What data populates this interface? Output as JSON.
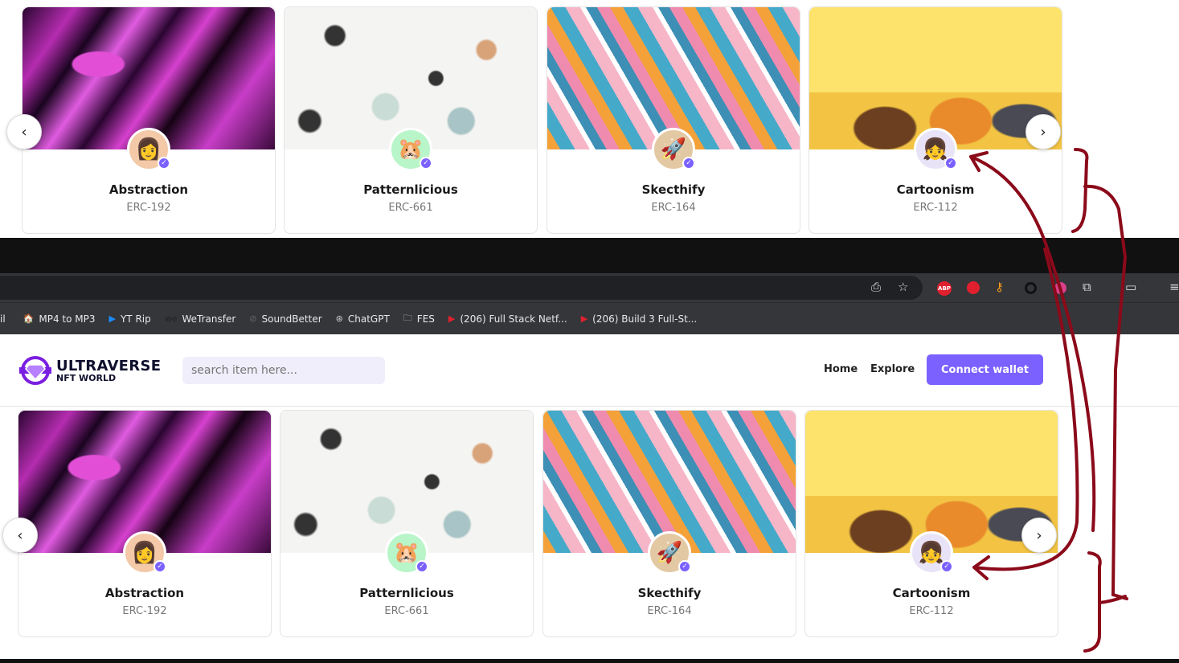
{
  "cards": [
    {
      "title": "Abstraction",
      "token": "ERC-192",
      "avatar_icon": "woman-avatar-icon",
      "avatar_bg": "#f3c9a8"
    },
    {
      "title": "Patternlicious",
      "token": "ERC-661",
      "avatar_icon": "hamster-avatar-icon",
      "avatar_bg": "#b8f5c8"
    },
    {
      "title": "Skecthify",
      "token": "ERC-164",
      "avatar_icon": "rocket-avatar-icon",
      "avatar_bg": "#e3c9a3"
    },
    {
      "title": "Cartoonism",
      "token": "ERC-112",
      "avatar_icon": "girl-avatar-icon",
      "avatar_bg": "#e9e3f7"
    }
  ],
  "carousel": {
    "prev": "‹",
    "next": "›"
  },
  "bookmarks": [
    "il",
    "MP4 to MP3",
    "YT Rip",
    "WeTransfer",
    "SoundBetter",
    "ChatGPT",
    "FES",
    "(206) Full Stack Netf...",
    "(206) Build 3 Full-St..."
  ],
  "header": {
    "logo_main": "ULTRAVERSE",
    "logo_sub": "NFT WORLD",
    "search_placeholder": "search item here...",
    "nav": [
      "Home",
      "Explore"
    ],
    "connect": "Connect wallet"
  },
  "colors": {
    "accent": "#7b61ff",
    "annotation": "#8b0a1a",
    "logo": "#7a1fe0"
  }
}
